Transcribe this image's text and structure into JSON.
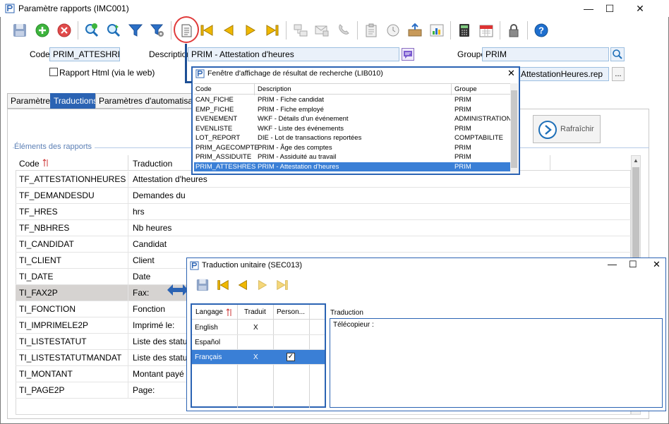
{
  "window": {
    "title": "Paramètre rapports (IMC001)"
  },
  "header": {
    "code_label": "Code",
    "code_value": "PRIM_ATTESHRES",
    "description_label": "Description",
    "description_value": "PRIM - Attestation d'heures",
    "group_label": "Groupe",
    "group_value": "PRIM",
    "html_report_label": "Rapport Html (via le web)",
    "file_value": "AttestationHeures.rep",
    "browse_label": "..."
  },
  "tabs": [
    "Paramètres",
    "Traductions",
    "Paramètres d'automatisation"
  ],
  "refresh_label": "Rafraîchir",
  "elements": {
    "section_label": "Éléments des rapports",
    "col_code": "Code",
    "col_traduction": "Traduction",
    "rows": [
      {
        "code": "TF_ATTESTATIONHEURES",
        "trad": "Attestation d'heures"
      },
      {
        "code": "TF_DEMANDESDU",
        "trad": "Demandes du"
      },
      {
        "code": "TF_HRES",
        "trad": "hrs"
      },
      {
        "code": "TF_NBHRES",
        "trad": "Nb heures"
      },
      {
        "code": "TI_CANDIDAT",
        "trad": "Candidat"
      },
      {
        "code": "TI_CLIENT",
        "trad": "Client"
      },
      {
        "code": "TI_DATE",
        "trad": "Date"
      },
      {
        "code": "TI_FAX2P",
        "trad": "Fax:"
      },
      {
        "code": "TI_FONCTION",
        "trad": "Fonction"
      },
      {
        "code": "TI_IMPRIMELE2P",
        "trad": "Imprimé le:"
      },
      {
        "code": "TI_LISTESTATUT",
        "trad": "Liste des statuts"
      },
      {
        "code": "TI_LISTESTATUTMANDAT",
        "trad": "Liste des statuts"
      },
      {
        "code": "TI_MONTANT",
        "trad": "Montant payé"
      },
      {
        "code": "TI_PAGE2P",
        "trad": "Page:"
      }
    ]
  },
  "search_popup": {
    "title": "Fenêtre d'affichage de résultat de recherche (LIB010)",
    "col_code": "Code",
    "col_description": "Description",
    "col_groupe": "Groupe",
    "rows": [
      {
        "code": "CAN_FICHE",
        "desc": "PRIM - Fiche candidat",
        "group": "PRIM"
      },
      {
        "code": "EMP_FICHE",
        "desc": "PRIM - Fiche employé",
        "group": "PRIM"
      },
      {
        "code": "EVENEMENT",
        "desc": "WKF - Détails d'un événement",
        "group": "ADMINISTRATION"
      },
      {
        "code": "EVENLISTE",
        "desc": "WKF - Liste des événements",
        "group": "PRIM"
      },
      {
        "code": "LOT_REPORT",
        "desc": "DIE - Lot de transactions reportées",
        "group": "COMPTABILITE"
      },
      {
        "code": "PRIM_AGECOMPTE",
        "desc": "PRIM - Âge des comptes",
        "group": "PRIM"
      },
      {
        "code": "PRIM_ASSIDUITE",
        "desc": "PRIM - Assiduité au travail",
        "group": "PRIM"
      },
      {
        "code": "PRIM_ATTESHRES",
        "desc": "PRIM - Attestation d'heures",
        "group": "PRIM"
      }
    ]
  },
  "translation_popup": {
    "title": "Traduction unitaire (SEC013)",
    "col_langage": "Langage",
    "col_traduit": "Traduit",
    "col_perso": "Person...",
    "traduction_label": "Traduction",
    "traduction_value": "Télécopieur :",
    "rows": [
      {
        "lang": "English",
        "traduit": "X"
      },
      {
        "lang": "Español",
        "traduit": ""
      },
      {
        "lang": "Français",
        "traduit": "X"
      }
    ]
  },
  "colors": {
    "accent": "#2b63b3",
    "selection": "#3a7fd6",
    "highlight_circle": "#e03a3a"
  }
}
